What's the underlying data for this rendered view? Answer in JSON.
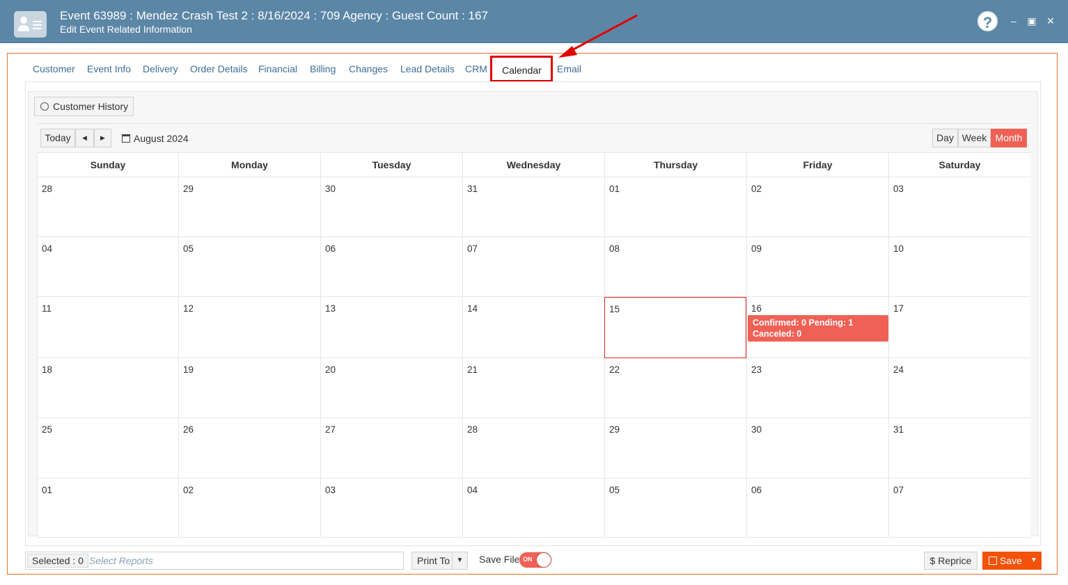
{
  "window": {
    "title": "Event 63989 : Mendez Crash Test 2 : 8/16/2024 : 709 Agency : Guest Count : 167",
    "subtitle": "Edit Event Related Information",
    "help_label": "?",
    "minimize_label": "–",
    "maximize_label": "▣",
    "close_label": "✕"
  },
  "tabs": [
    {
      "label": "Customer"
    },
    {
      "label": "Event Info"
    },
    {
      "label": "Delivery"
    },
    {
      "label": "Order Details"
    },
    {
      "label": "Financial"
    },
    {
      "label": "Billing"
    },
    {
      "label": "Changes"
    },
    {
      "label": "Lead Details"
    },
    {
      "label": "CRM"
    },
    {
      "label": "Calendar",
      "active": true
    },
    {
      "label": "Email"
    }
  ],
  "toolbar": {
    "customer_history_label": "Customer History"
  },
  "calendar": {
    "today_label": "Today",
    "prev_label": "◀",
    "next_label": "▶",
    "month_label": "August 2024",
    "views": [
      "Day",
      "Week",
      "Month"
    ],
    "active_view": "Month",
    "weekdays": [
      "Sunday",
      "Monday",
      "Tuesday",
      "Wednesday",
      "Thursday",
      "Friday",
      "Saturday"
    ],
    "weeks": [
      [
        "28",
        "29",
        "30",
        "31",
        "01",
        "02",
        "03"
      ],
      [
        "04",
        "05",
        "06",
        "07",
        "08",
        "09",
        "10"
      ],
      [
        "11",
        "12",
        "13",
        "14",
        "15",
        "16",
        "17"
      ],
      [
        "18",
        "19",
        "20",
        "21",
        "22",
        "23",
        "24"
      ],
      [
        "25",
        "26",
        "27",
        "28",
        "29",
        "30",
        "31"
      ],
      [
        "01",
        "02",
        "03",
        "04",
        "05",
        "06",
        "07"
      ]
    ],
    "today_highlight": "15",
    "event": {
      "day": "16",
      "line1": "Confirmed: 0 Pending: 1",
      "line2": "Canceled: 0"
    }
  },
  "footer": {
    "selected_label": "Selected : 0",
    "reports_placeholder": "Select Reports",
    "print_label": "Print To",
    "save_file_label": "Save File",
    "toggle_label": "ON",
    "reprice_label": "$  Reprice",
    "save_label": "Save"
  },
  "colors": {
    "titlebar": "#5b86a6",
    "accent": "#f06155",
    "save": "#f4510b",
    "tab_link": "#3b6e97",
    "highlight_box": "#e00000"
  }
}
